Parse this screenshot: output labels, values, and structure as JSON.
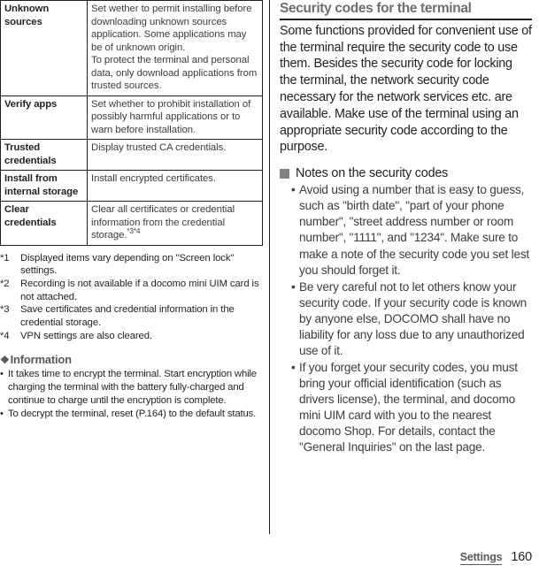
{
  "document": {
    "footer": {
      "chapter": "Settings",
      "page_number": "160"
    }
  },
  "left_column": {
    "table": {
      "rows": [
        {
          "name": "Unknown sources",
          "description_paragraphs": [
            "Set wether to permit installing before downloading unknown sources application. Some applications may be of unknown origin.",
            "To protect the terminal and personal data, only download applications from trusted sources."
          ],
          "footnote_marks": ""
        },
        {
          "name": "Verify apps",
          "description_paragraphs": [
            "Set whether to prohibit installation of possibly harmful applications or to warn before installation."
          ],
          "footnote_marks": ""
        },
        {
          "name": "Trusted credentials",
          "description_paragraphs": [
            "Display trusted CA credentials."
          ],
          "footnote_marks": ""
        },
        {
          "name": "Install from internal storage",
          "description_paragraphs": [
            "Install encrypted certificates."
          ],
          "footnote_marks": ""
        },
        {
          "name": "Clear credentials",
          "description_paragraphs": [
            "Clear all certificates or credential information from the credential storage."
          ],
          "footnote_marks": "*3*4"
        }
      ]
    },
    "footnotes": [
      {
        "mark": "*1",
        "text": "Displayed items vary depending on \"Screen lock\" settings."
      },
      {
        "mark": "*2",
        "text": "Recording is not available if a docomo mini UIM card is not attached."
      },
      {
        "mark": "*3",
        "text": "Save certificates and credential information in the credential storage."
      },
      {
        "mark": "*4",
        "text": "VPN settings are also cleared."
      }
    ],
    "information": {
      "bullet_glyph": "❖",
      "title": "Information",
      "items": [
        "It takes time to encrypt the terminal. Start encryption while charging the terminal with the battery fully-charged and continue to charge until the encryption is complete.",
        "To decrypt the terminal, reset (P.164) to the default status."
      ]
    }
  },
  "right_column": {
    "section_title": "Security codes for the terminal",
    "intro_paragraph": "Some functions provided for convenient use of the terminal require the security code to use them. Besides the security code for locking the terminal, the network security code necessary for the network services etc. are available. Make use of the terminal using an appropriate security code according to the purpose.",
    "subsection": {
      "title": "Notes on the security codes",
      "items": [
        "Avoid using a number that is easy to guess, such as \"birth date\", \"part of your phone number\", \"street address number or room number\", \"1111\", and \"1234\". Make sure to make a note of the security code you set lest you should forget it.",
        "Be very careful not to let others know your security code. If your security code is known by anyone else, DOCOMO shall have no liability for any loss due to any unauthorized use of it.",
        "If you forget your security codes, you must bring your official identification (such as drivers license), the terminal, and docomo mini UIM card with you to the nearest docomo Shop. For details, contact the \"General Inquiries\" on the last page."
      ]
    }
  },
  "colors": {
    "text": "#231f20",
    "muted_text": "#3d3b3c",
    "heading_gray": "#6d6e71",
    "square_bullet": "#808285",
    "rule": "#231f20"
  }
}
